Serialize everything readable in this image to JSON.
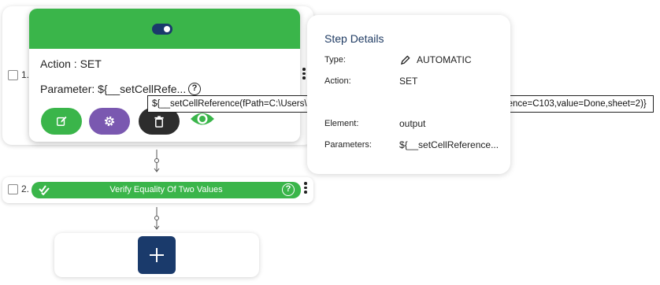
{
  "steps": [
    {
      "number": "1.",
      "popup": {
        "action_line": "Action : SET",
        "parameter_line": "Parameter: ${__setCellRefe..."
      }
    },
    {
      "number": "2.",
      "label": "Verify Equality Of Two Values"
    }
  ],
  "tooltip": {
    "text": "${__setCellReference(fPath=C:\\Users\\nidhi.singh\\Downloads\\BBFunctions.xlsx,cellReference=C103,value=Done,sheet=2)}"
  },
  "details": {
    "title": "Step Details",
    "rows": [
      {
        "label": "Type:",
        "value": "AUTOMATIC"
      },
      {
        "label": "Action:",
        "value": "SET"
      },
      {
        "label": "Element:",
        "value": "output"
      },
      {
        "label": "Parameters:",
        "value": "${__setCellReference..."
      }
    ]
  },
  "icons": {
    "edit": "edit-icon",
    "settings": "gear-icon",
    "delete": "trash-icon",
    "view": "eye-icon",
    "type": "pencil-icon",
    "verify": "double-check-icon",
    "help": "help-icon",
    "add": "plus-icon"
  },
  "colors": {
    "green": "#3ab54a",
    "purple": "#7a58b0",
    "dark": "#2d2d2d",
    "navy": "#1a3a6b",
    "title_blue": "#1f3b63"
  }
}
